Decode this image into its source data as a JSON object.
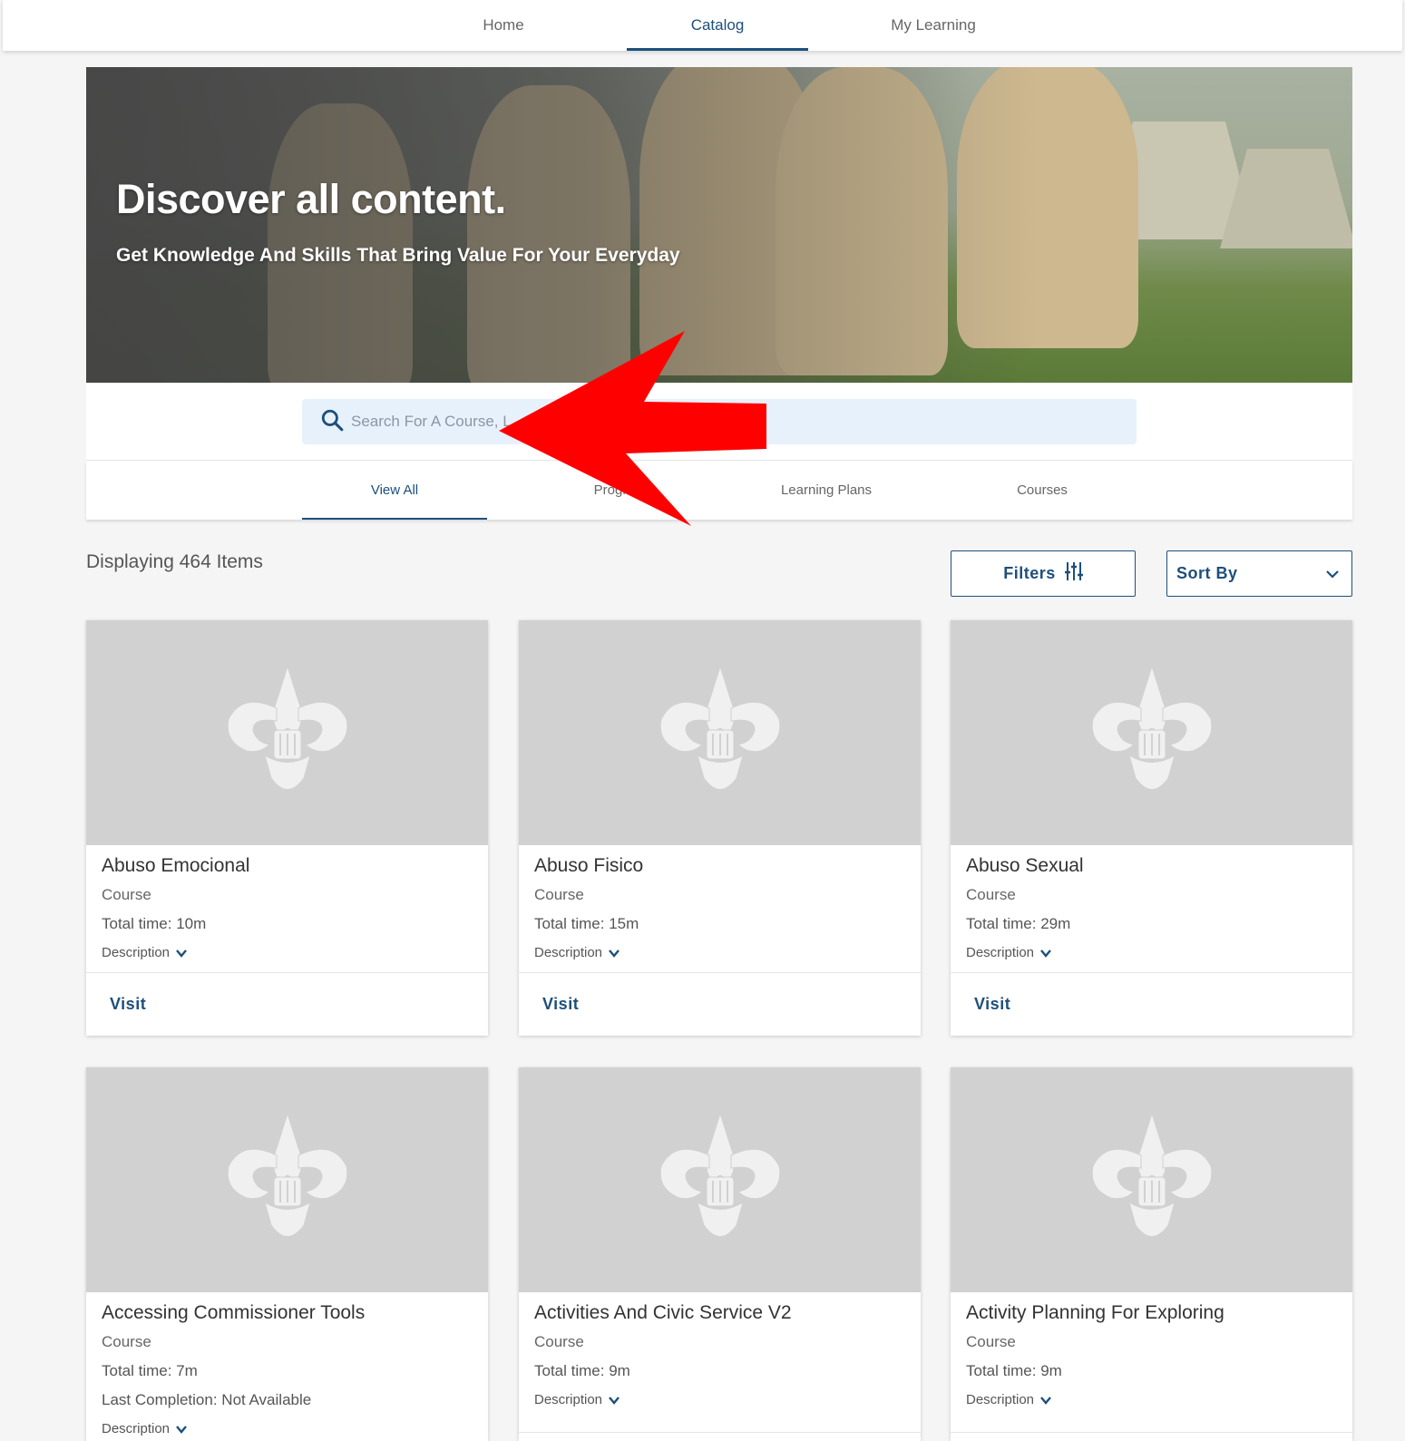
{
  "nav": {
    "items": [
      {
        "label": "Home"
      },
      {
        "label": "Catalog",
        "active": true
      },
      {
        "label": "My Learning"
      }
    ]
  },
  "hero": {
    "title": "Discover all content.",
    "subtitle": "Get Knowledge And Skills That Bring Value For Your Everyday"
  },
  "search": {
    "placeholder": "Search For A Course, L",
    "icon": "search-icon"
  },
  "tabs": [
    {
      "label": "View All",
      "active": true
    },
    {
      "label": "Progr"
    },
    {
      "label": "Learning Plans"
    },
    {
      "label": "Courses"
    }
  ],
  "toolbar": {
    "count_label": "Displaying 464 Items",
    "filters_label": "Filters",
    "filters_icon": "sliders-icon",
    "sort_label": "Sort By",
    "sort_icon": "chevron-down-icon"
  },
  "annotation": {
    "arrow_color": "#ff0000",
    "arrow_icon": "red-arrow-pointing-left"
  },
  "colors": {
    "accent": "#1d4f7c",
    "search_bg": "#e6f1fc",
    "thumb_bg": "#d1d1d1"
  },
  "cards": [
    {
      "title": "Abuso Emocional",
      "type": "Course",
      "time": "Total time: 10m",
      "description_label": "Description",
      "visit_label": "Visit"
    },
    {
      "title": "Abuso Fisico",
      "type": "Course",
      "time": "Total time: 15m",
      "description_label": "Description",
      "visit_label": "Visit"
    },
    {
      "title": "Abuso Sexual",
      "type": "Course",
      "time": "Total time: 29m",
      "description_label": "Description",
      "visit_label": "Visit"
    },
    {
      "title": "Accessing Commissioner Tools",
      "type": "Course",
      "time": "Total time: 7m",
      "completion": "Last Completion: Not Available",
      "description_label": "Description"
    },
    {
      "title": "Activities And Civic Service V2",
      "type": "Course",
      "time": "Total time: 9m",
      "description_label": "Description"
    },
    {
      "title": "Activity Planning For Exploring",
      "type": "Course",
      "time": "Total time: 9m",
      "description_label": "Description"
    }
  ]
}
